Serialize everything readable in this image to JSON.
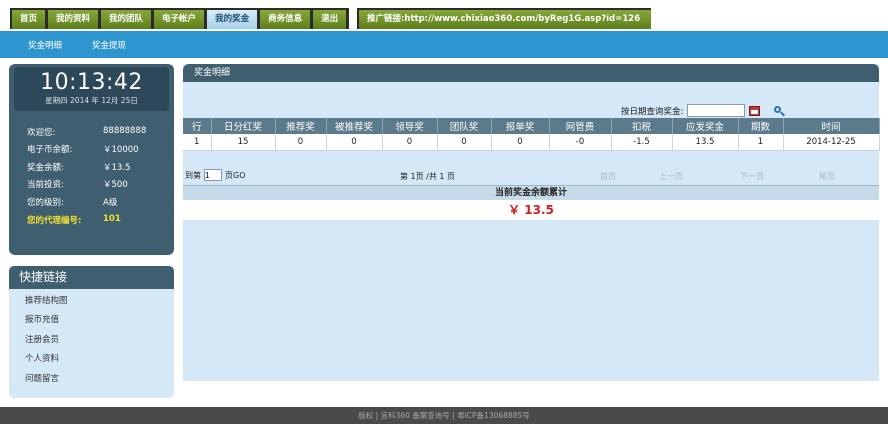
{
  "nav": {
    "tabs": [
      "首页",
      "我的资料",
      "我的团队",
      "电子帐户",
      "我的奖金",
      "商务信息",
      "退出"
    ],
    "active_index": 4,
    "promo_label": "推广链接:",
    "promo_url": "http://www.chixiao360.com/byReg1G.asp?id=126"
  },
  "subnav": [
    "奖金明细",
    "奖金提现"
  ],
  "clock": {
    "time": "10:13:42",
    "date": "星期四 2014 年 12月 25日"
  },
  "account": {
    "rows": [
      {
        "label": "欢迎您:",
        "value": "88888888"
      },
      {
        "label": "电子币余额:",
        "value": "￥10000"
      },
      {
        "label": "奖金余额:",
        "value": "￥13.5"
      },
      {
        "label": "当前投资:",
        "value": "￥500"
      },
      {
        "label": "您的级别:",
        "value": "A级"
      }
    ],
    "agent_label": "您的代理编号:",
    "agent_value": "101"
  },
  "quick_links": {
    "title": "快捷链接",
    "items": [
      "推荐结构图",
      "报币充值",
      "注册会员",
      "个人资料",
      "问题留言"
    ]
  },
  "main": {
    "title": "奖金明细",
    "query_label": "按日期查询奖金:",
    "query_value": "",
    "columns": [
      "行",
      "日分红奖",
      "推荐奖",
      "被推荐奖",
      "领导奖",
      "团队奖",
      "报单奖",
      "网管费",
      "扣税",
      "应发奖金",
      "期数",
      "时间"
    ],
    "rows": [
      [
        "1",
        "15",
        "0",
        "0",
        "0",
        "0",
        "0",
        "-0",
        "-1.5",
        "13.5",
        "1",
        "2014-12-25"
      ]
    ],
    "pager": {
      "goto_prefix": "到第",
      "goto_value": "1",
      "goto_suffix": "页GO",
      "info": "第  1页  /共  1 页",
      "links": [
        "首页",
        "上一页",
        "下一页",
        "尾页"
      ]
    },
    "total_label": "当前奖金余额累计",
    "total_value": "￥ 13.5"
  },
  "footer": "版权 | 宜科360 备案查询号 | 粤ICP备13068885号",
  "colors": {
    "nav_green": "#6f8f2a",
    "subnav_blue": "#2d95cf",
    "panel_dark": "#3f5e6f",
    "content_bg": "#d5e8f8",
    "total_red": "#cc2020"
  }
}
